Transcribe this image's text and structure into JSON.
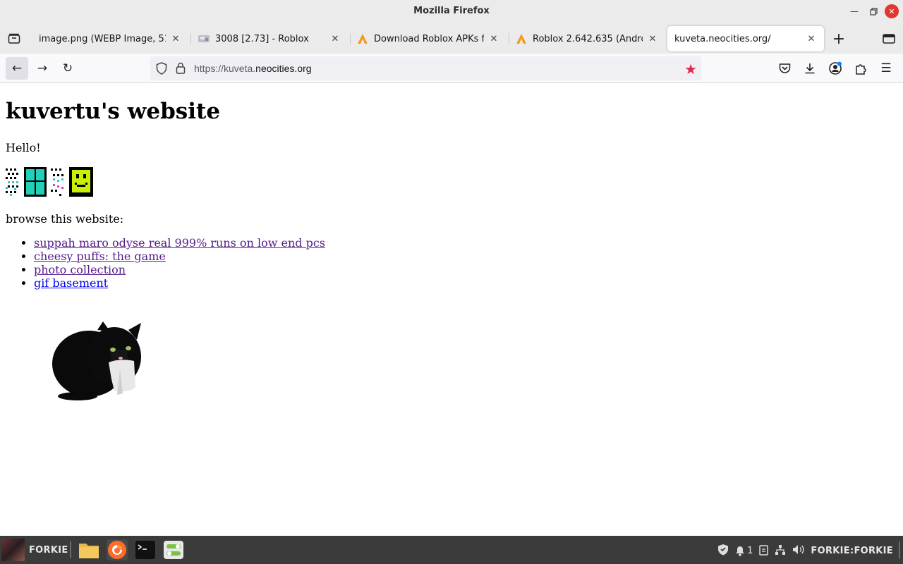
{
  "window": {
    "title": "Mozilla Firefox"
  },
  "tabs": [
    {
      "label": "image.png (WEBP Image, 512 ×",
      "icon": "image-tab-icon",
      "active": false
    },
    {
      "label": "3008 [2.73] - Roblox",
      "icon": "roblox-game-thumbnail-icon",
      "active": false
    },
    {
      "label": "Download Roblox APKs for",
      "icon": "apkmirror-icon",
      "active": false
    },
    {
      "label": "Roblox 2.642.635 (Android",
      "icon": "apkmirror-icon",
      "active": false
    },
    {
      "label": "kuveta.neocities.org/",
      "icon": "",
      "active": true
    }
  ],
  "urlbar": {
    "scheme_path": "https://kuveta.",
    "domain": "neocities.org"
  },
  "page": {
    "title": "kuvertu's website",
    "greeting": "Hello!",
    "browse_label": "browse this website:",
    "links": [
      {
        "label": "suppah maro odyse real 999% runs on low end pcs"
      },
      {
        "label": "cheesy puffs: the game"
      },
      {
        "label": "photo collection"
      },
      {
        "label": "gif basement"
      }
    ]
  },
  "taskbar": {
    "username": "FORKIE",
    "notification_count": "1",
    "clock": "FORKIE:FORKIE"
  },
  "colors": {
    "visited_link": "#551a8b",
    "unvisited_link": "#0000ee",
    "bookmark_star": "#e22850",
    "close_button": "#e0362c",
    "apkmirror_orange": "#f29a1f"
  }
}
